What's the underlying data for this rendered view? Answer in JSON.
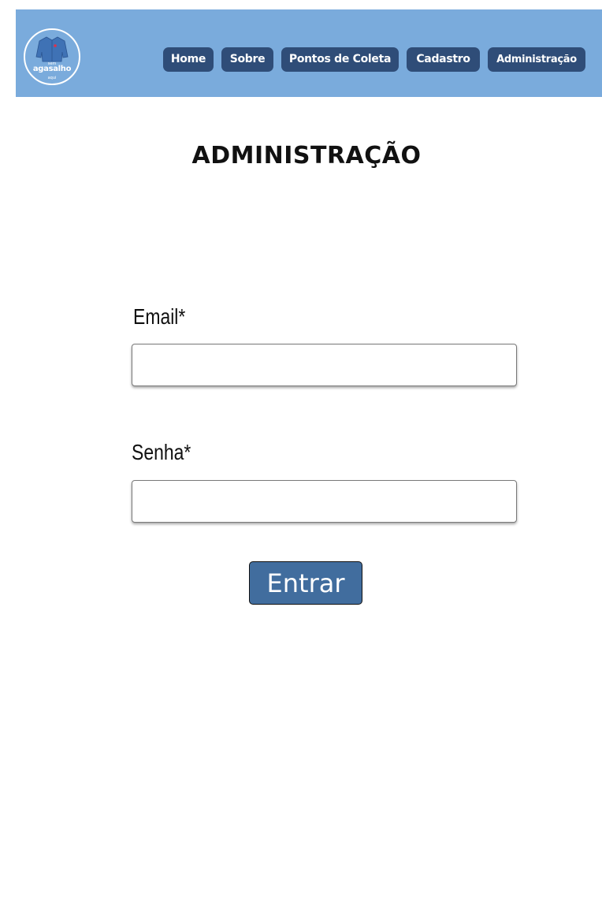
{
  "header": {
    "logo": {
      "top_text": "sem",
      "main_text": "agasalho",
      "bottom_text": "aqui"
    },
    "nav": [
      {
        "id": "home",
        "label": "Home"
      },
      {
        "id": "sobre",
        "label": "Sobre"
      },
      {
        "id": "pontos",
        "label": "Pontos de Coleta"
      },
      {
        "id": "cadastro",
        "label": "Cadastro"
      },
      {
        "id": "administracao",
        "label": "Administração"
      }
    ]
  },
  "main": {
    "title": "ADMINISTRAÇÃO",
    "email": {
      "label": "Email*",
      "value": ""
    },
    "password": {
      "label": "Senha*",
      "value": ""
    },
    "submit_label": "Entrar"
  },
  "colors": {
    "header_bg": "#7aabdc",
    "nav_button_bg": "#2f4d78",
    "submit_bg": "#416d9e"
  }
}
